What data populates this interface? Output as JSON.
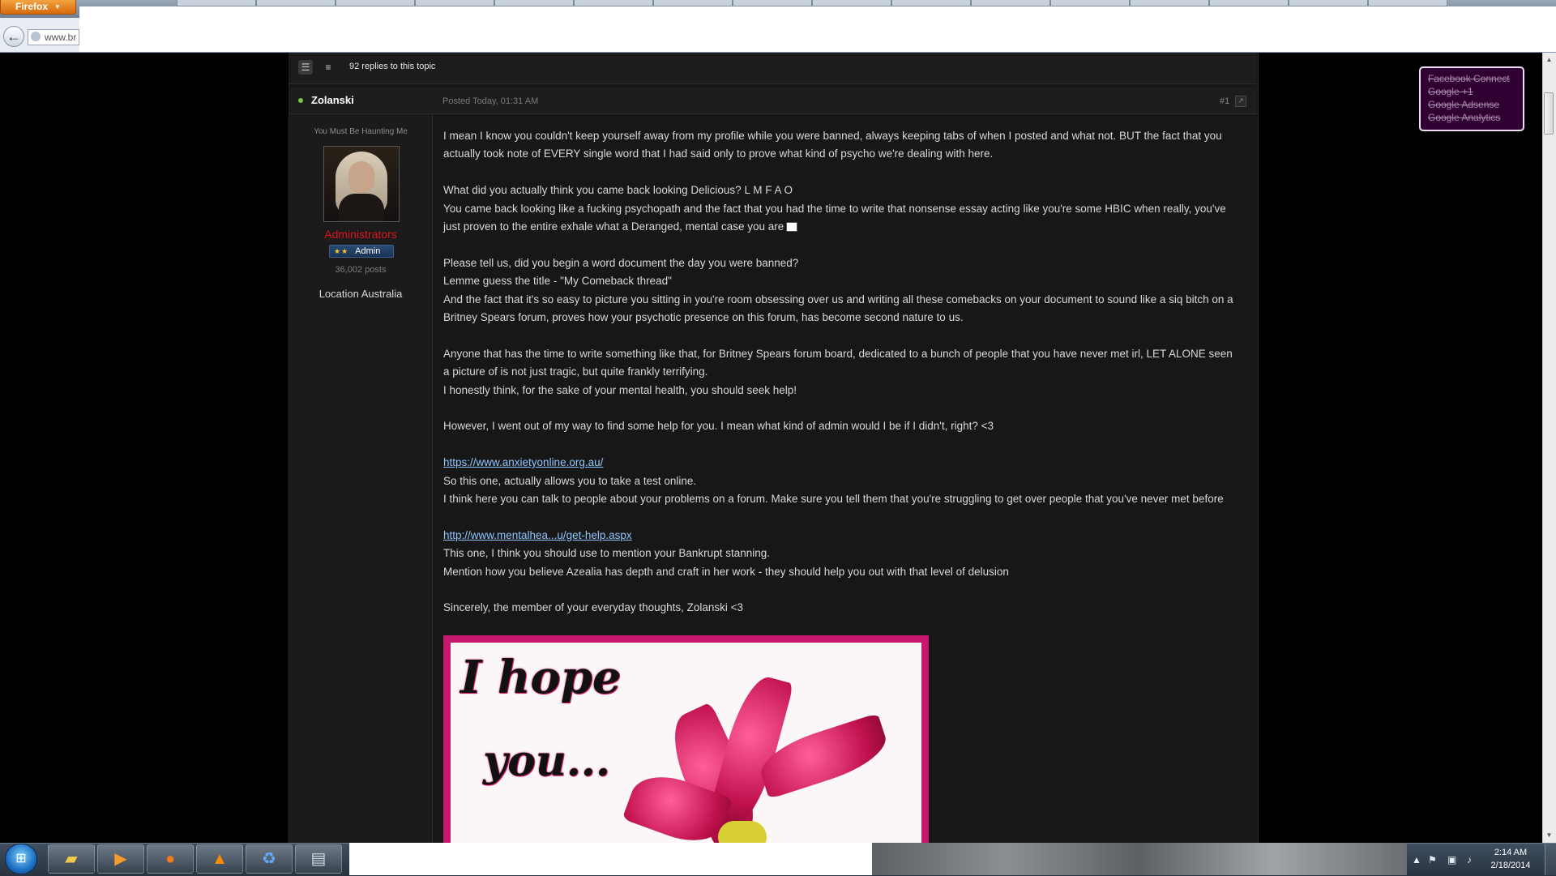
{
  "browser": {
    "menu_label": "Firefox",
    "url_partial": "www.br"
  },
  "topic": {
    "replies_label": "92 replies to this topic"
  },
  "post": {
    "author": "Zolanski",
    "posted": "Posted Today, 01:31 AM",
    "number": "#1",
    "member_title": "You Must Be Haunting Me",
    "group": "Administrators",
    "badge_label": "Admin",
    "post_count": "36,002 posts",
    "location": "Location Australia",
    "paragraphs": [
      "I mean I know you couldn't keep yourself away from my profile while you were banned, always keeping tabs of when I posted and what not. BUT the fact that you actually took note of EVERY single word that I had said only to prove what kind of psycho we're dealing with here.",
      "What did you actually think you came back looking Delicious? L M F A O",
      "You came back looking like a fucking psychopath and the fact that you had the time to write that nonsense essay acting like you're some HBIC when really, you've just proven to the entire exhale what a Deranged, mental case you are",
      "Please tell us, did you begin a word document the day you were banned?",
      "Lemme guess the title - \"My Comeback thread\"",
      "And the fact that it's so easy to picture you sitting in you're room obsessing over us and writing all these comebacks on your document to sound like a siq bitch on a Britney Spears forum, proves how your psychotic presence on this forum, has become second nature to us.",
      "Anyone that has the time to write something like that, for Britney Spears forum board, dedicated to a bunch of people that you have never met irl, LET ALONE seen a picture of is not just tragic, but quite frankly terrifying.",
      "I honestly think, for the sake of your mental health, you should seek help!",
      "However, I went out of my way to find some help for you. I mean what kind of admin would I be if I didn't, right? <3",
      "https://www.anxietyonline.org.au/",
      "So this one, actually allows you to take a test online.",
      "I think here you can talk to people about your problems on a forum. Make sure you tell them that you're struggling to get over people that you've never met before",
      "http://www.mentalhea...u/get-help.aspx",
      "This one, I think you should use to mention your Bankrupt stanning.",
      "Mention how you believe Azealia has depth and craft in her work - they should help you out with that level of delusion",
      "Sincerely, the member of your everyday thoughts, Zolanski <3"
    ],
    "image_text_line1": "I hope",
    "image_text_line2": "you..."
  },
  "blocker": {
    "items": [
      "Facebook Connect",
      "Google +1",
      "Google Adsense",
      "Google Analytics"
    ]
  },
  "taskbar": {
    "time": "2:14 AM",
    "date": "2/18/2014",
    "apps": [
      "file-explorer",
      "media-player",
      "firefox",
      "vlc",
      "recycle",
      "app"
    ]
  },
  "colors": {
    "group": "#e0141e",
    "link": "#8fc6ff",
    "blocker_bg": "#300032",
    "image_border": "#c8186e"
  }
}
